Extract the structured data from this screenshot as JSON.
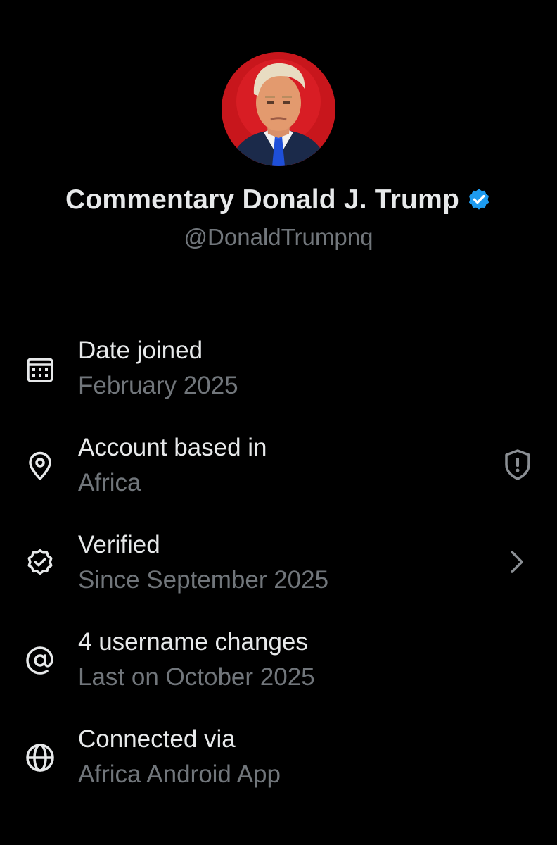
{
  "profile": {
    "display_name": "Commentary Donald J. Trump",
    "handle": "@DonaldTrumpnq",
    "verified": true,
    "avatar_icon": "profile-photo",
    "accent_color": "#1d9bf0"
  },
  "about": {
    "items": [
      {
        "icon": "calendar-icon",
        "title": "Date joined",
        "subtitle": "February 2025"
      },
      {
        "icon": "location-pin-icon",
        "title": "Account based in",
        "subtitle": "Africa",
        "action_icon": "shield-alert-icon"
      },
      {
        "icon": "verified-badge-outline-icon",
        "title": "Verified",
        "subtitle": "Since September 2025",
        "action_icon": "chevron-right-icon"
      },
      {
        "icon": "at-sign-icon",
        "title": "4 username changes",
        "subtitle": "Last on October 2025"
      },
      {
        "icon": "globe-icon",
        "title": "Connected via",
        "subtitle": "Africa Android App"
      }
    ]
  },
  "colors": {
    "background": "#000000",
    "primary_text": "#e7e9ea",
    "secondary_text": "#71767b",
    "verified_blue": "#1d9bf0"
  }
}
